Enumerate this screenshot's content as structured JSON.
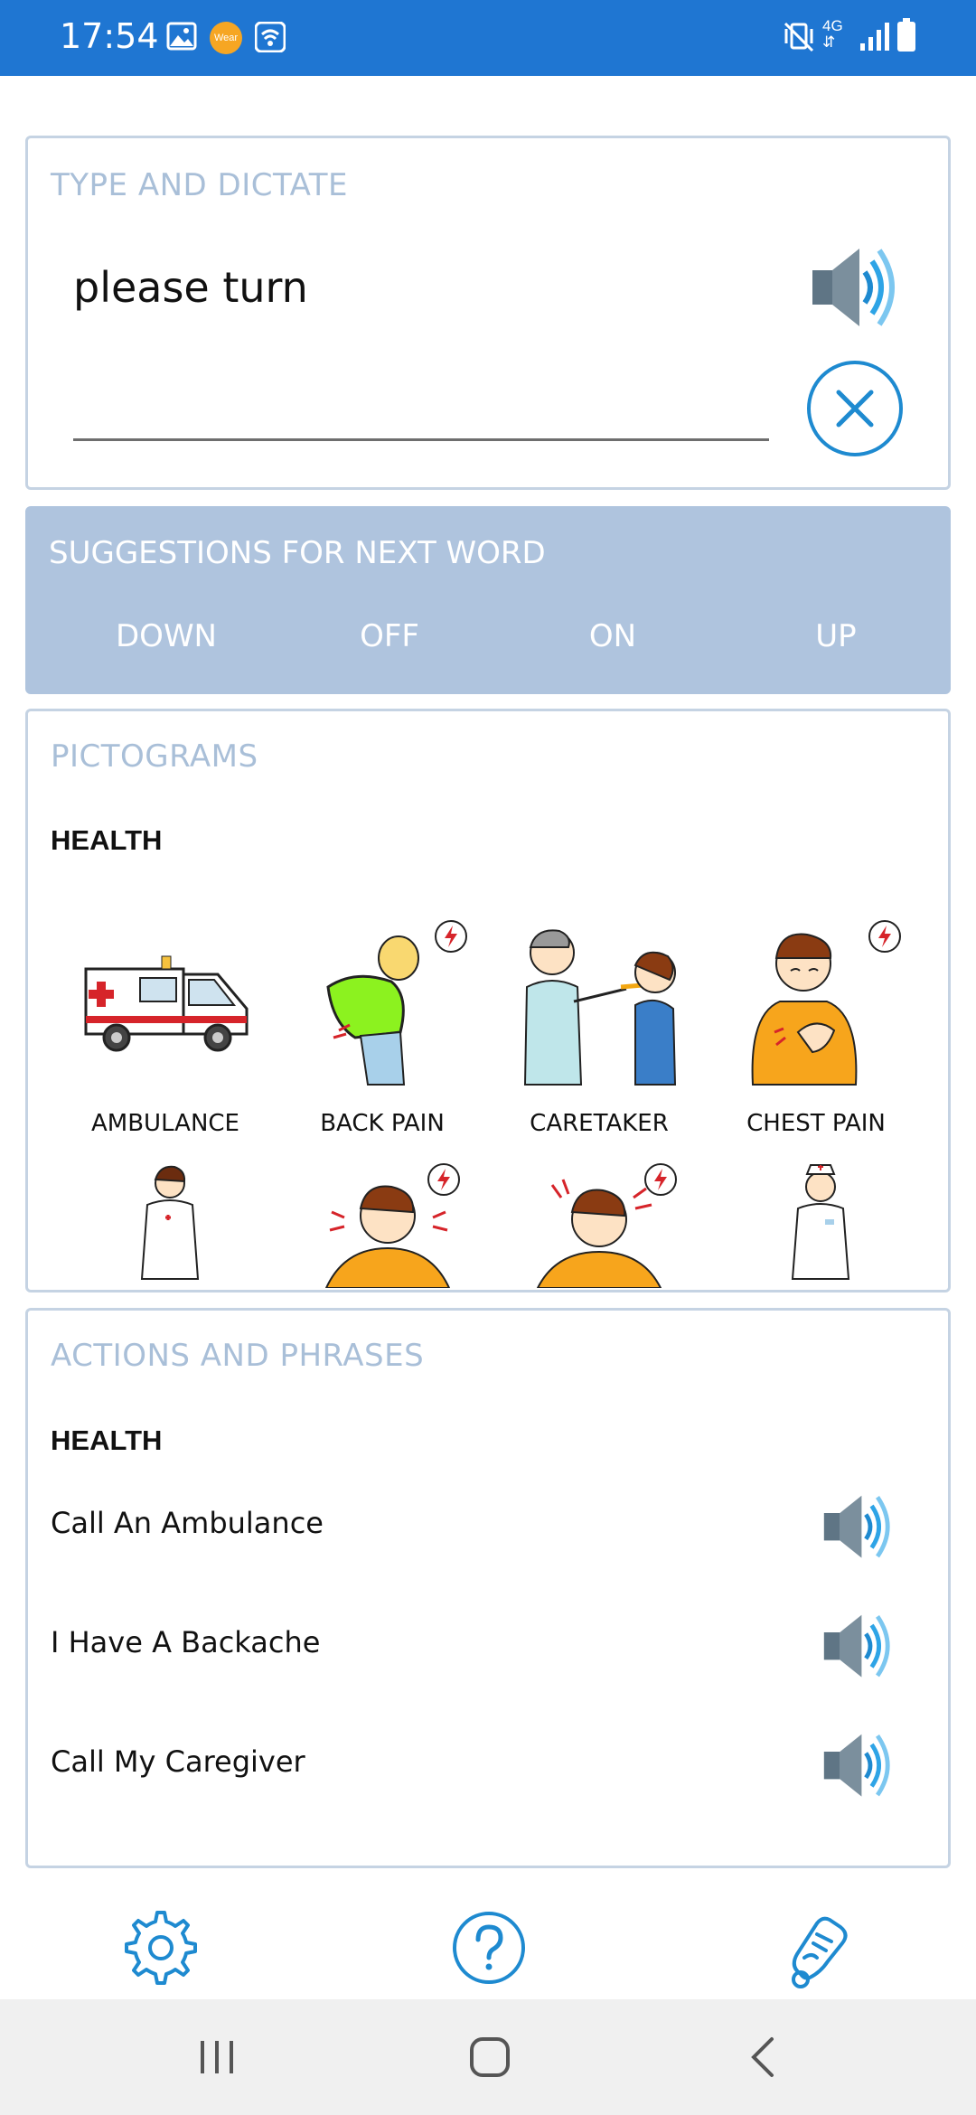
{
  "status_bar": {
    "time": "17:54",
    "wear_label": "Wear",
    "network": "4G",
    "icons": [
      "image-icon",
      "wear-app-icon",
      "wifi-calling-icon",
      "vibrate-icon",
      "network-4g-icon",
      "signal-icon",
      "battery-icon"
    ]
  },
  "type_and_dictate": {
    "title": "TYPE AND DICTATE",
    "text": "please turn"
  },
  "suggestions": {
    "title": "SUGGESTIONS FOR NEXT WORD",
    "words": [
      "DOWN",
      "OFF",
      "ON",
      "UP"
    ]
  },
  "pictograms": {
    "title": "PICTOGRAMS",
    "category": "HEALTH",
    "items": [
      {
        "label": "AMBULANCE"
      },
      {
        "label": "BACK PAIN"
      },
      {
        "label": "CARETAKER"
      },
      {
        "label": "CHEST PAIN"
      }
    ]
  },
  "actions": {
    "title": "ACTIONS AND PHRASES",
    "category": "HEALTH",
    "phrases": [
      {
        "text": "Call An Ambulance"
      },
      {
        "text": "I Have A Backache"
      },
      {
        "text": "Call My Caregiver"
      }
    ]
  },
  "colors": {
    "accent": "#1f76d2",
    "card_border": "#c5d3e3",
    "title": "#a9bfd8",
    "suggestion_bg": "#afc4de",
    "icon_blue": "#1e8ad0"
  }
}
